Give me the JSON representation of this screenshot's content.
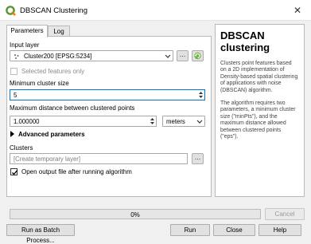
{
  "window": {
    "title": "DBSCAN Clustering",
    "close_glyph": "✕"
  },
  "tabs": [
    {
      "label": "Parameters"
    },
    {
      "label": "Log"
    }
  ],
  "form": {
    "input_layer_label": "Input layer",
    "input_layer_value": "Cluster200 [EPSG:5234]",
    "browse_glyph": "…",
    "selected_only_label": "Selected features only",
    "selected_only_checked": false,
    "min_cluster_label": "Minimum cluster size",
    "min_cluster_value": "5",
    "max_dist_label": "Maximum distance between clustered points",
    "max_dist_value": "1.000000",
    "unit_value": "meters",
    "advanced_label": "Advanced parameters",
    "clusters_label": "Clusters",
    "clusters_placeholder": "[Create temporary layer]",
    "open_output_label": "Open output file after running algorithm",
    "open_output_checked": true
  },
  "help": {
    "title": "DBSCAN clustering",
    "paragraphs": [
      "Clusters point features based on a 2D implementation of Density-based spatial clustering of applications with noise (DBSCAN) algorithm.",
      "The algorithm requires two parameters, a minimum cluster size (\"minPts\"), and the maximum distance allowed between clustered points (\"eps\")."
    ]
  },
  "progress": {
    "value": 0,
    "text": "0%"
  },
  "buttons": {
    "cancel": "Cancel",
    "batch": "Run as Batch Process...",
    "run": "Run",
    "close": "Close",
    "help": "Help"
  },
  "colors": {
    "accent": "#0078d7",
    "qgis_green": "#589632",
    "progress_green": "#06b025"
  }
}
